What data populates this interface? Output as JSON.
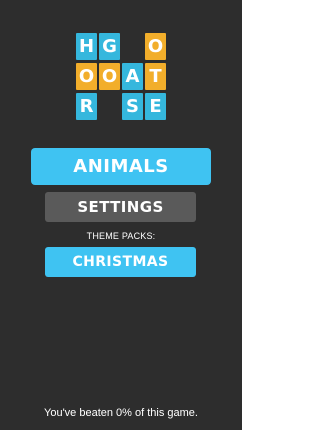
{
  "logo": {
    "tiles": [
      {
        "letter": "H",
        "color": "#35b7dd"
      },
      {
        "letter": "G",
        "color": "#35b7dd"
      },
      {
        "letter": "O",
        "color": "#f2ae2b"
      },
      {
        "letter": "O",
        "color": "#f2ae2b"
      },
      {
        "letter": "O",
        "color": "#f2ae2b"
      },
      {
        "letter": "A",
        "color": "#35b7dd"
      },
      {
        "letter": "T",
        "color": "#f2ae2b"
      },
      {
        "letter": "R",
        "color": "#35b7dd"
      },
      {
        "letter": "S",
        "color": "#35b7dd"
      },
      {
        "letter": "E",
        "color": "#35b7dd"
      }
    ]
  },
  "menu": {
    "primary_label": "ANIMALS",
    "settings_label": "SETTINGS",
    "theme_packs_label": "THEME PACKS:",
    "theme_pack_label": "CHRISTMAS"
  },
  "footer": {
    "progress_text": "You've beaten 0% of this game."
  },
  "colors": {
    "background": "#2d2d2d",
    "accent_blue": "#3fc3f2",
    "accent_orange": "#f2ae2b",
    "settings_gray": "#5a5a5a"
  }
}
